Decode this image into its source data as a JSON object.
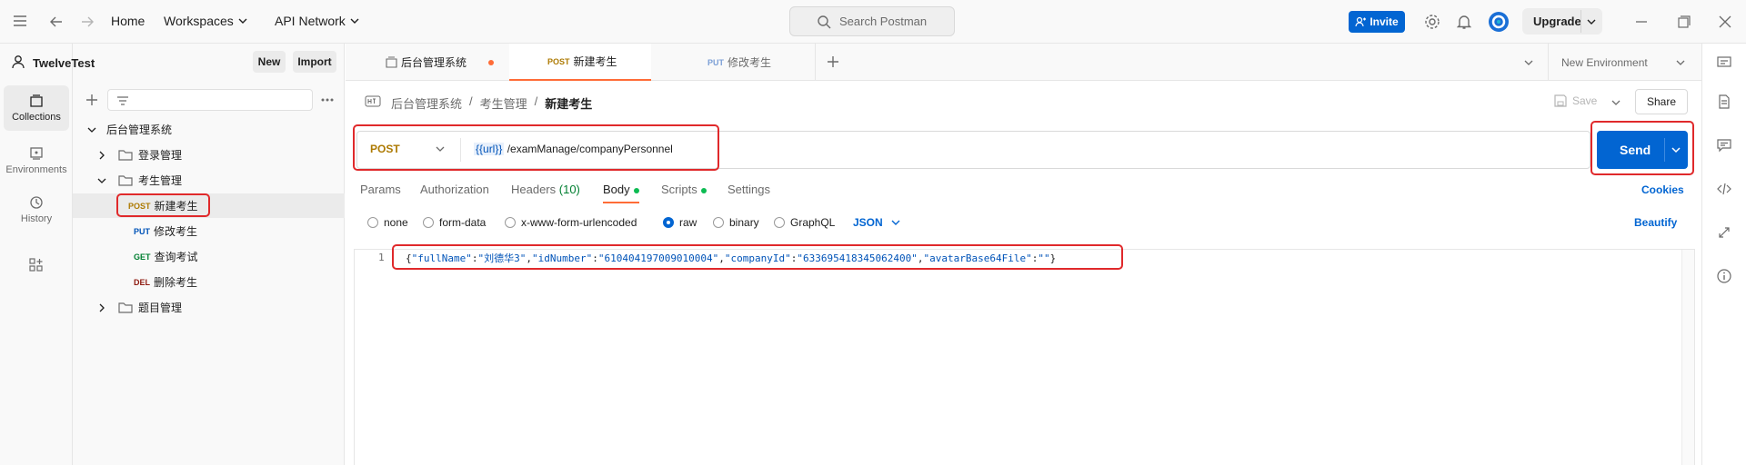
{
  "topbar": {
    "home": "Home",
    "workspaces": "Workspaces",
    "api_network": "API Network",
    "search_placeholder": "Search Postman",
    "invite": "Invite",
    "upgrade": "Upgrade"
  },
  "workspace": {
    "name": "TwelveTest",
    "new": "New",
    "import": "Import"
  },
  "rail": [
    {
      "label": "Collections",
      "icon": "collections-icon"
    },
    {
      "label": "Environments",
      "icon": "environments-icon"
    },
    {
      "label": "History",
      "icon": "history-icon"
    }
  ],
  "tree": {
    "collection": "后台管理系统",
    "folders": [
      "登录管理",
      "考生管理",
      "题目管理"
    ],
    "requests": [
      {
        "method": "POST",
        "name": "新建考生"
      },
      {
        "method": "PUT",
        "name": "修改考生"
      },
      {
        "method": "GET",
        "name": "查询考试"
      },
      {
        "method": "DEL",
        "name": "删除考生"
      }
    ]
  },
  "tabs": [
    {
      "label": "后台管理系统",
      "method": ""
    },
    {
      "label": "新建考生",
      "method": "POST"
    },
    {
      "label": "修改考生",
      "method": "PUT"
    }
  ],
  "environment": "New Environment",
  "breadcrumb": {
    "collection": "后台管理系统",
    "folder": "考生管理",
    "request": "新建考生",
    "save": "Save",
    "share": "Share"
  },
  "request": {
    "method": "POST",
    "url_var": "{{url}}",
    "url_path": "/examManage/companyPersonnel",
    "send": "Send"
  },
  "request_tabs": {
    "params": "Params",
    "authorization": "Authorization",
    "headers": "Headers",
    "headers_count": "(10)",
    "body": "Body",
    "scripts": "Scripts",
    "settings": "Settings",
    "cookies": "Cookies"
  },
  "body_types": {
    "none": "none",
    "form_data": "form-data",
    "urlencoded": "x-www-form-urlencoded",
    "raw": "raw",
    "binary": "binary",
    "graphql": "GraphQL",
    "format": "JSON",
    "beautify": "Beautify"
  },
  "editor": {
    "line_number": "1",
    "brace_open": "{",
    "k1": "\"fullName\"",
    "v1": "\"刘德华3\"",
    "k2": "\"idNumber\"",
    "v2": "\"610404197009010004\"",
    "k3": "\"companyId\"",
    "v3": "\"633695418345062400\"",
    "k4": "\"avatarBase64File\"",
    "v4": "\"\"",
    "brace_close": "}"
  },
  "colors": {
    "accent": "#0265d2",
    "tab_active": "#ff6c37",
    "highlight": "#e0292b",
    "post": "#ad7a03"
  }
}
